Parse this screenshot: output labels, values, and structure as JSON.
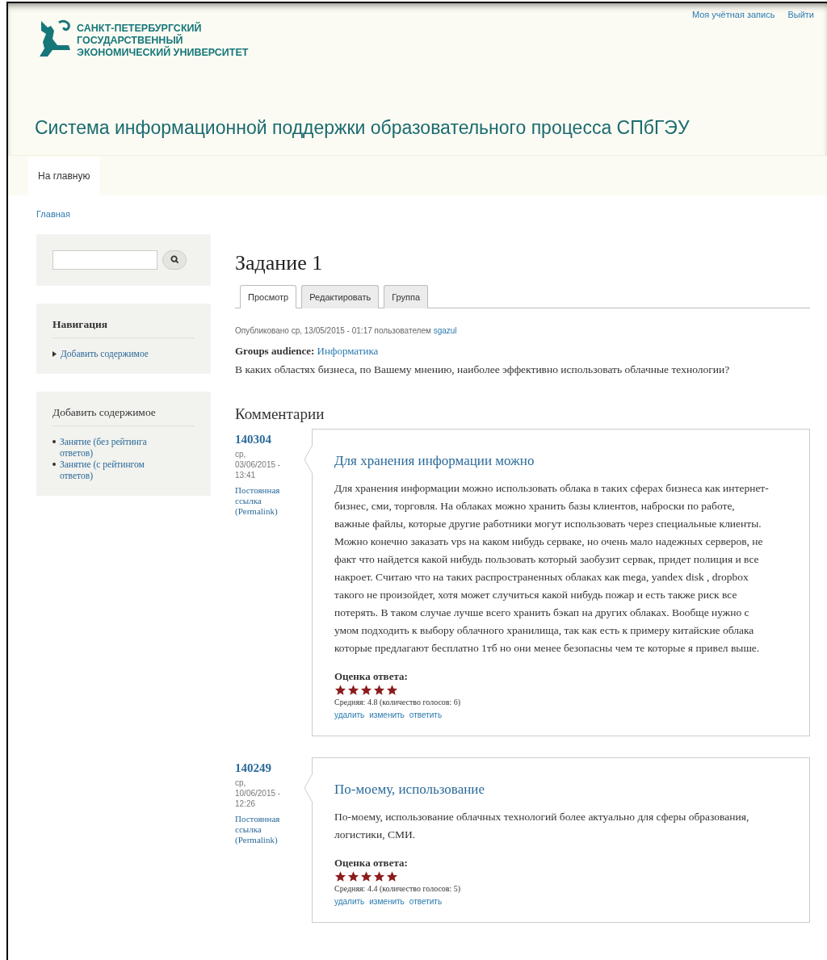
{
  "logo": {
    "lines": [
      "САНКТ-ПЕТЕРБУРГСКИЙ",
      "ГОСУДАРСТВЕННЫЙ",
      "ЭКОНОМИЧЕСКИЙ УНИВЕРСИТЕТ"
    ]
  },
  "user_menu": [
    "Моя учётная запись",
    "Выйти"
  ],
  "site_title": "Система информационной поддержки образовательного процесса СПбГЭУ",
  "main_menu": [
    {
      "label": "На главную",
      "selected": true
    }
  ],
  "breadcrumb": "Главная",
  "sidebar": {
    "blocks": [
      {
        "title": "Навигация",
        "kind": "tree",
        "items": [
          "Добавить содержимое"
        ]
      },
      {
        "title": "Добавить содержимое",
        "kind": "bullets",
        "items": [
          "Занятие (без рейтинга ответов)",
          "Занятие (с рейтингом ответов)"
        ]
      }
    ]
  },
  "node": {
    "title": "Задание 1",
    "tabs": [
      {
        "label": "Просмотр",
        "selected": true
      },
      {
        "label": "Редактировать",
        "selected": false
      },
      {
        "label": "Группа",
        "selected": false
      }
    ],
    "submitted": "Опубликовано ср, 13/05/2015 - 01:17 пользователем",
    "author": "sgazul",
    "groups_label": "Groups audience:",
    "groups_value": "Информатика",
    "body": "В каких областях бизнеса, по Вашему мнению, наиболее эффективно использовать облачные технологии?"
  },
  "comments_title": "Комментарии",
  "comments": [
    {
      "author": "140304",
      "date": "ср, 03/06/2015 - 13:41",
      "permalink": "Постоянная ссылка (Permalink)",
      "title": "Для хранения информации можно",
      "body": "Для хранения информации можно использовать облака в таких сферах бизнеса как интернет-бизнес, сми, торговля. На облаках можно хранить базы клиентов, наброски по работе, важные файлы, которые другие работники могут использовать через специальные клиенты. Можно конечно заказать vps на каком нибудь серваке, но очень мало надежных серверов, не факт что найдется какой нибудь пользовать который заобузит сервак, придет полиция и все накроет. Считаю что на таких распространенных облаках как mega, yandex disk , dropbox такого не произойдет, хотя может случиться какой нибудь пожар и есть также риск все потерять. В таком случае лучше всего хранить бэкап на других облаках. Вообще нужно с умом подходить к выбору облачного хранилища, так как есть к примеру китайские облака которые предлагают бесплатно 1тб но они менее безопасны чем те которые я привел выше.",
      "rating_label": "Оценка ответа:",
      "stars": 5,
      "average": "Средняя: 4.8 (количество голосов: 6)",
      "links": [
        "удалить",
        "изменить",
        "ответить"
      ]
    },
    {
      "author": "140249",
      "date": "ср, 10/06/2015 - 12:26",
      "permalink": "Постоянная ссылка (Permalink)",
      "title": "По-моему, использование",
      "body": "По-моему, использование облачных технологий более актуально для сферы образования, логистики, СМИ.",
      "rating_label": "Оценка ответа:",
      "stars": 5,
      "average": "Средняя: 4.4 (количество голосов: 5)",
      "links": [
        "удалить",
        "изменить",
        "ответить"
      ]
    }
  ]
}
